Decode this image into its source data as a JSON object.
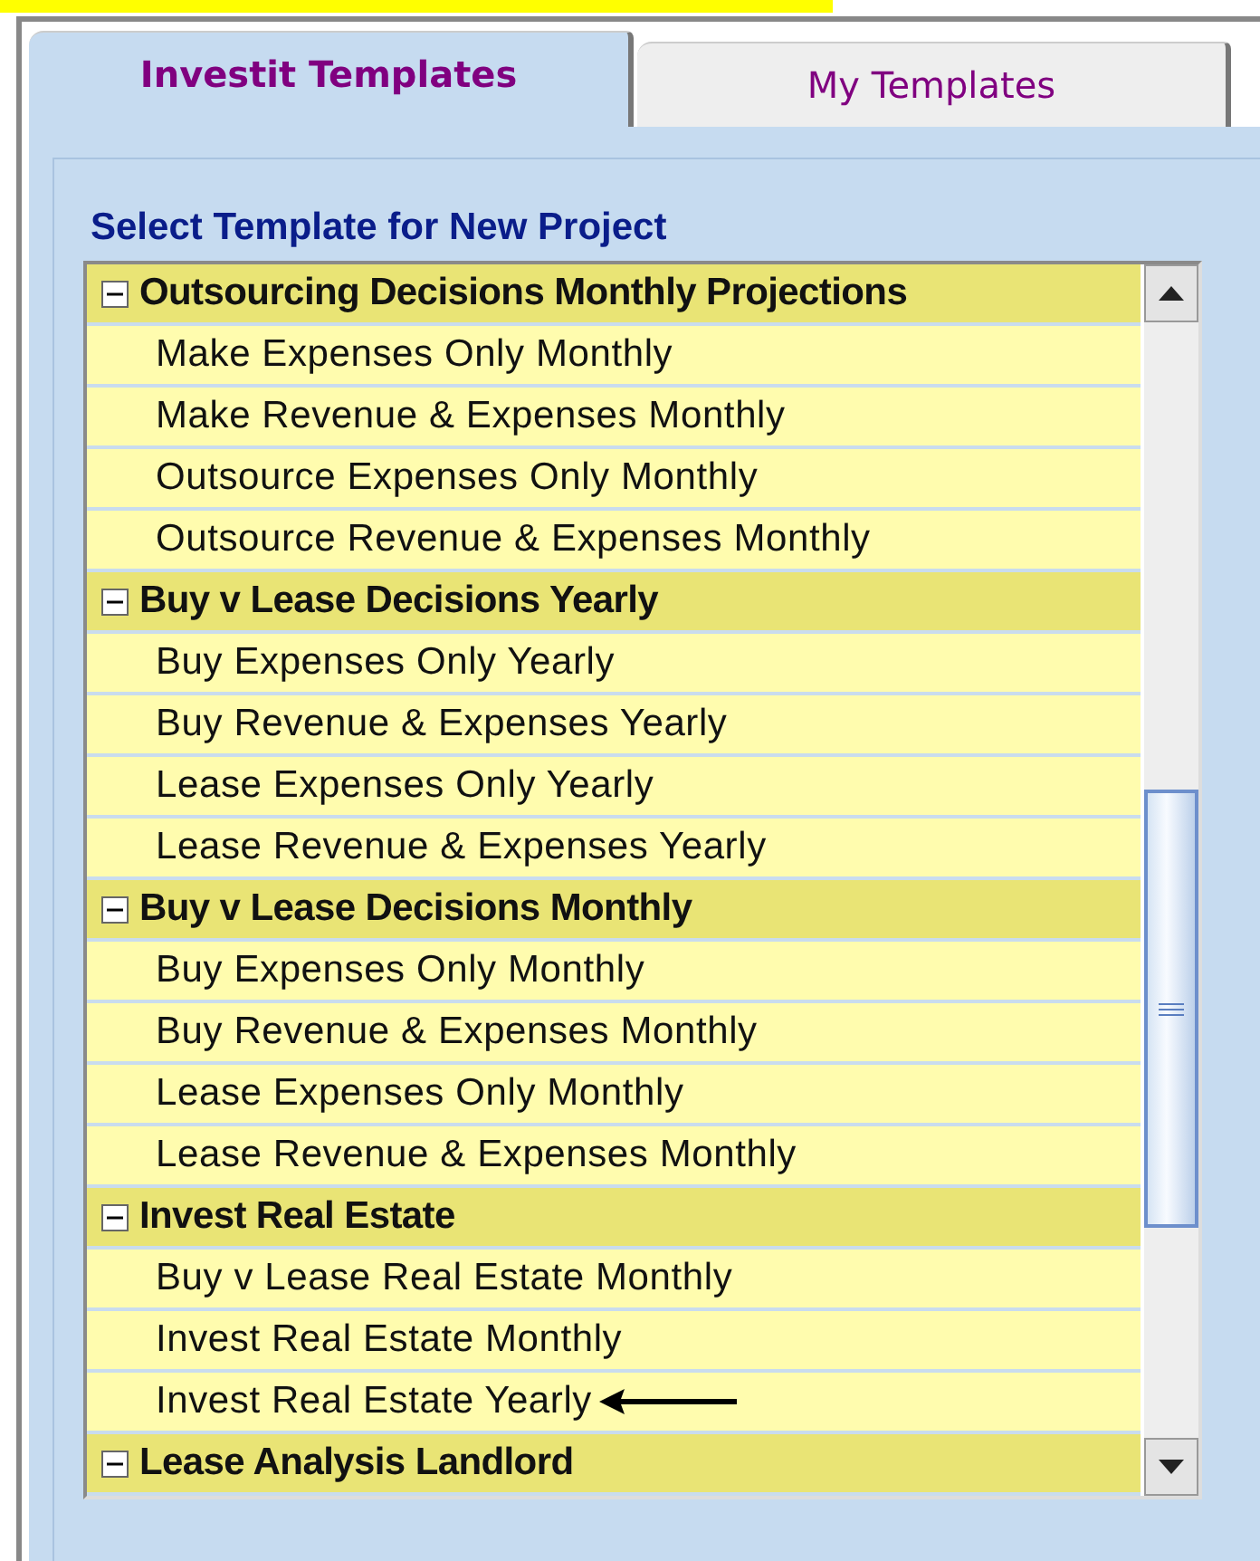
{
  "tabs": [
    {
      "label": "Investit Templates",
      "selected": true
    },
    {
      "label": "My Templates",
      "selected": false
    }
  ],
  "group_title": "Select Template for New Project",
  "tree": [
    {
      "label": "Outsourcing Decisions Monthly Projections",
      "expanded": true,
      "children": [
        {
          "label": "Make Expenses Only Monthly"
        },
        {
          "label": "Make Revenue & Expenses Monthly"
        },
        {
          "label": "Outsource Expenses Only Monthly"
        },
        {
          "label": "Outsource Revenue & Expenses Monthly"
        }
      ]
    },
    {
      "label": "Buy v Lease Decisions Yearly",
      "expanded": true,
      "children": [
        {
          "label": "Buy Expenses Only Yearly"
        },
        {
          "label": "Buy Revenue & Expenses Yearly"
        },
        {
          "label": "Lease Expenses Only Yearly"
        },
        {
          "label": "Lease Revenue & Expenses Yearly"
        }
      ]
    },
    {
      "label": "Buy v Lease Decisions Monthly",
      "expanded": true,
      "children": [
        {
          "label": "Buy Expenses Only Monthly"
        },
        {
          "label": "Buy Revenue & Expenses Monthly"
        },
        {
          "label": "Lease Expenses Only Monthly"
        },
        {
          "label": "Lease Revenue & Expenses Monthly"
        }
      ]
    },
    {
      "label": "Invest Real Estate",
      "expanded": true,
      "children": [
        {
          "label": "Buy v Lease Real Estate Monthly"
        },
        {
          "label": "Invest Real Estate Monthly"
        },
        {
          "label": "Invest Real Estate Yearly",
          "pointed": true
        }
      ]
    },
    {
      "label": "Lease Analysis Landlord",
      "expanded": true
    }
  ]
}
